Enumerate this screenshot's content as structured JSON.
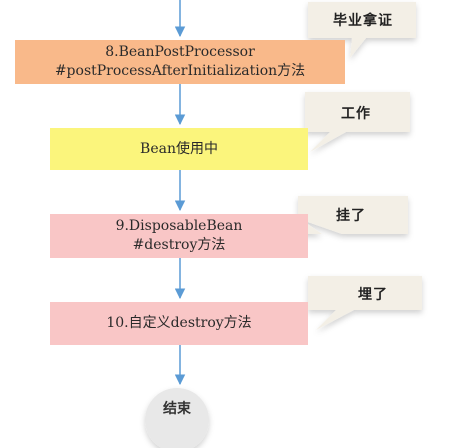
{
  "steps": {
    "s8": {
      "line1": "8.BeanPostProcessor",
      "line2": "#postProcessAfterInitialization方法"
    },
    "use": {
      "line1": "Bean使用中"
    },
    "s9": {
      "line1": "9.DisposableBean",
      "line2": "#destroy方法"
    },
    "s10": {
      "line1": "10.自定义destroy方法"
    }
  },
  "end": {
    "label": "结束"
  },
  "notes": {
    "graduate": "毕业拿证",
    "work": "工作",
    "hang": "挂了",
    "bury": "埋了"
  },
  "colors": {
    "orange": "#f9b98a",
    "yellow": "#fbf57c",
    "pink": "#f9c6c6",
    "arrow": "#5b9bd5",
    "note_bg": "#f3efe6",
    "end_circle": "#e8e8e8"
  }
}
